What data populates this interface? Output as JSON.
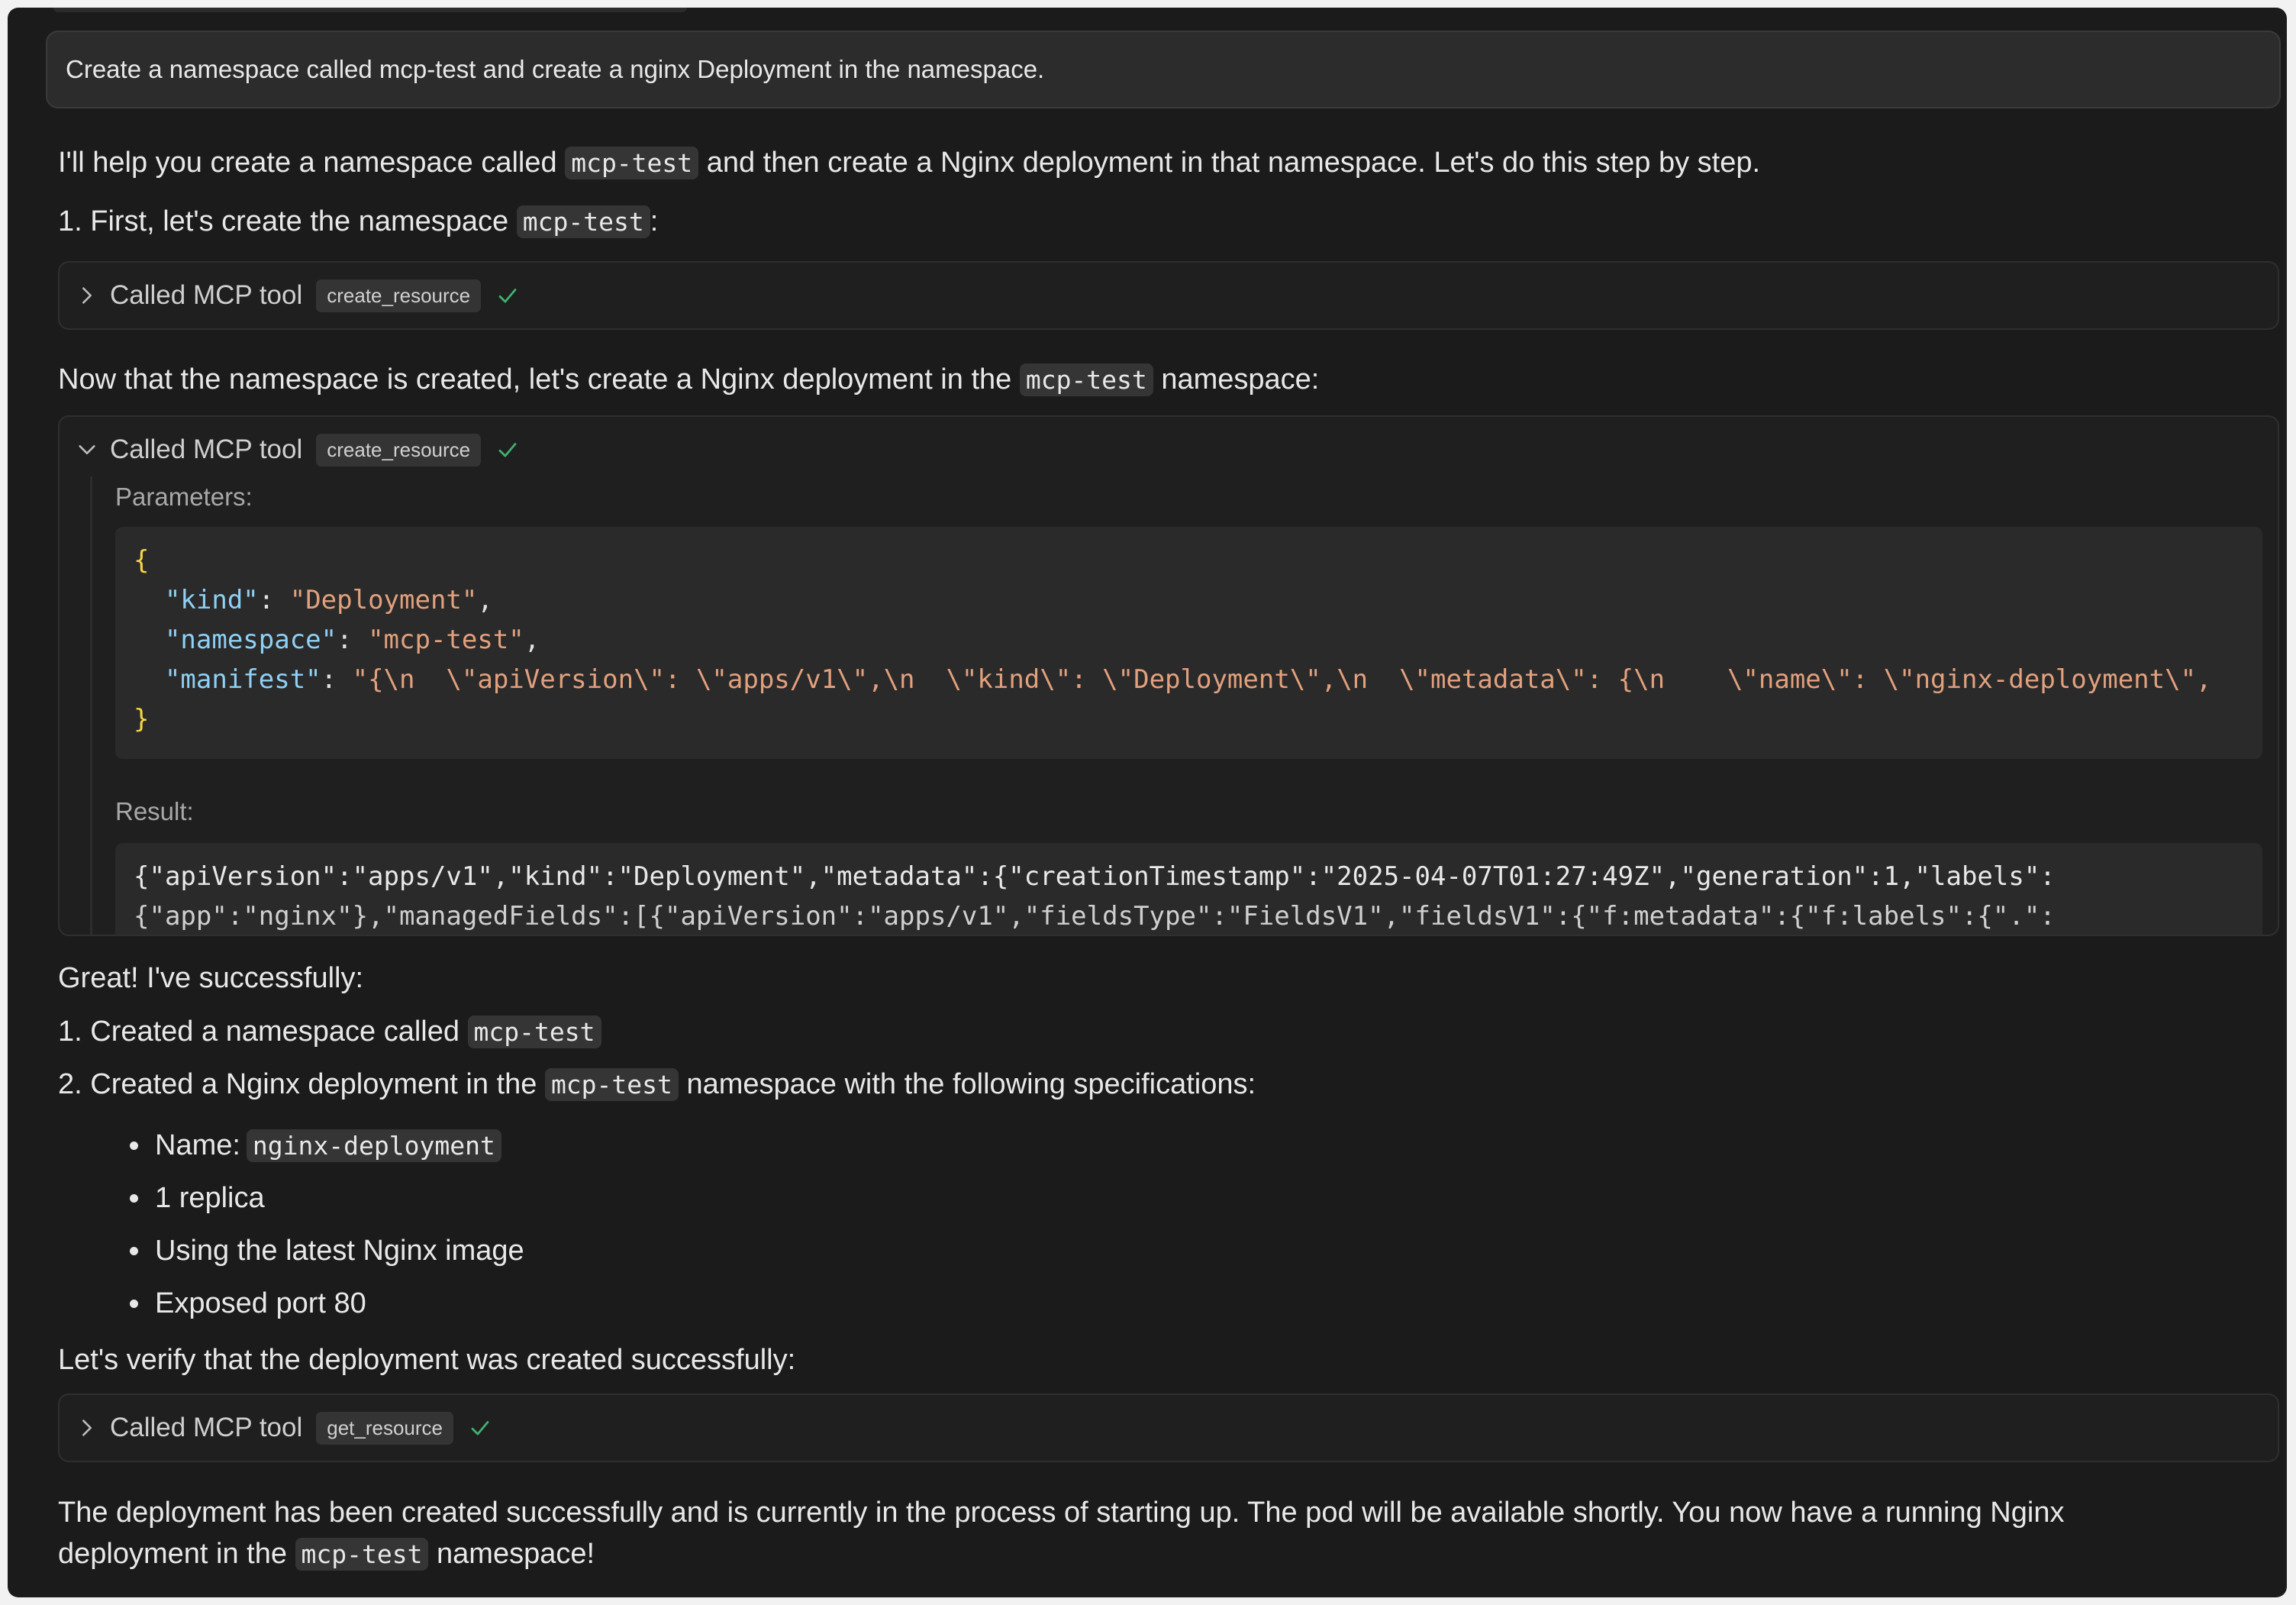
{
  "user_message": "Create a namespace called mcp-test and create a nginx Deployment in the namespace.",
  "intro": {
    "before": "I'll help you create a namespace called ",
    "code": "mcp-test",
    "after": " and then create a Nginx deployment in that namespace. Let's do this step by step."
  },
  "step1": {
    "before": "1. First, let's create the namespace ",
    "code": "mcp-test",
    "after": ":"
  },
  "tool_calls": [
    {
      "label": "Called MCP tool",
      "tool": "create_resource",
      "expanded": false
    },
    {
      "label": "Called MCP tool",
      "tool": "create_resource",
      "expanded": true
    },
    {
      "label": "Called MCP tool",
      "tool": "get_resource",
      "expanded": false
    }
  ],
  "now_para": {
    "before": "Now that the namespace is created, let's create a Nginx deployment in the ",
    "code": "mcp-test",
    "after": " namespace:"
  },
  "parameters": {
    "label": "Parameters:",
    "open_brace": "{",
    "close_brace": "}",
    "lines": [
      {
        "key": "\"kind\"",
        "value": "\"Deployment\"",
        "trail": ","
      },
      {
        "key": "\"namespace\"",
        "value": "\"mcp-test\"",
        "trail": ","
      },
      {
        "key": "\"manifest\"",
        "value": "\"{\\n  \\\"apiVersion\\\": \\\"apps/v1\\\",\\n  \\\"kind\\\": \\\"Deployment\\\",\\n  \\\"metadata\\\": {\\n    \\\"name\\\": \\\"nginx-deployment\\\",",
        "trail": ""
      }
    ]
  },
  "result": {
    "label": "Result:",
    "line1": "{\"apiVersion\":\"apps/v1\",\"kind\":\"Deployment\",\"metadata\":{\"creationTimestamp\":\"2025-04-07T01:27:49Z\",\"generation\":1,\"labels\":",
    "line2": "{\"app\":\"nginx\"},\"managedFields\":[{\"apiVersion\":\"apps/v1\",\"fieldsType\":\"FieldsV1\",\"fieldsV1\":{\"f:metadata\":{\"f:labels\":{\".\":"
  },
  "great": "Great! I've successfully:",
  "list1": {
    "before": "1. Created a namespace called ",
    "code": "mcp-test"
  },
  "list2": {
    "before": "2. Created a Nginx deployment in the ",
    "code": "mcp-test",
    "after": " namespace with the following specifications:"
  },
  "bullets": {
    "name_label": "Name: ",
    "name_code": "nginx-deployment",
    "replica": "1 replica",
    "image": "Using the latest Nginx image",
    "port": "Exposed port 80"
  },
  "verify": "Let's verify that the deployment was created successfully:",
  "final": {
    "line1": "The deployment has been created successfully and is currently in the process of starting up. The pod will be available shortly. You now have a running Nginx",
    "line2_before": "deployment in the ",
    "line2_code": "mcp-test",
    "line2_after": " namespace!"
  },
  "colors": {
    "background": "#1b1b1b",
    "check": "#3fb26f",
    "json_key": "#8fd0f5",
    "json_string": "#e2a07d",
    "json_brace": "#f5d547"
  }
}
